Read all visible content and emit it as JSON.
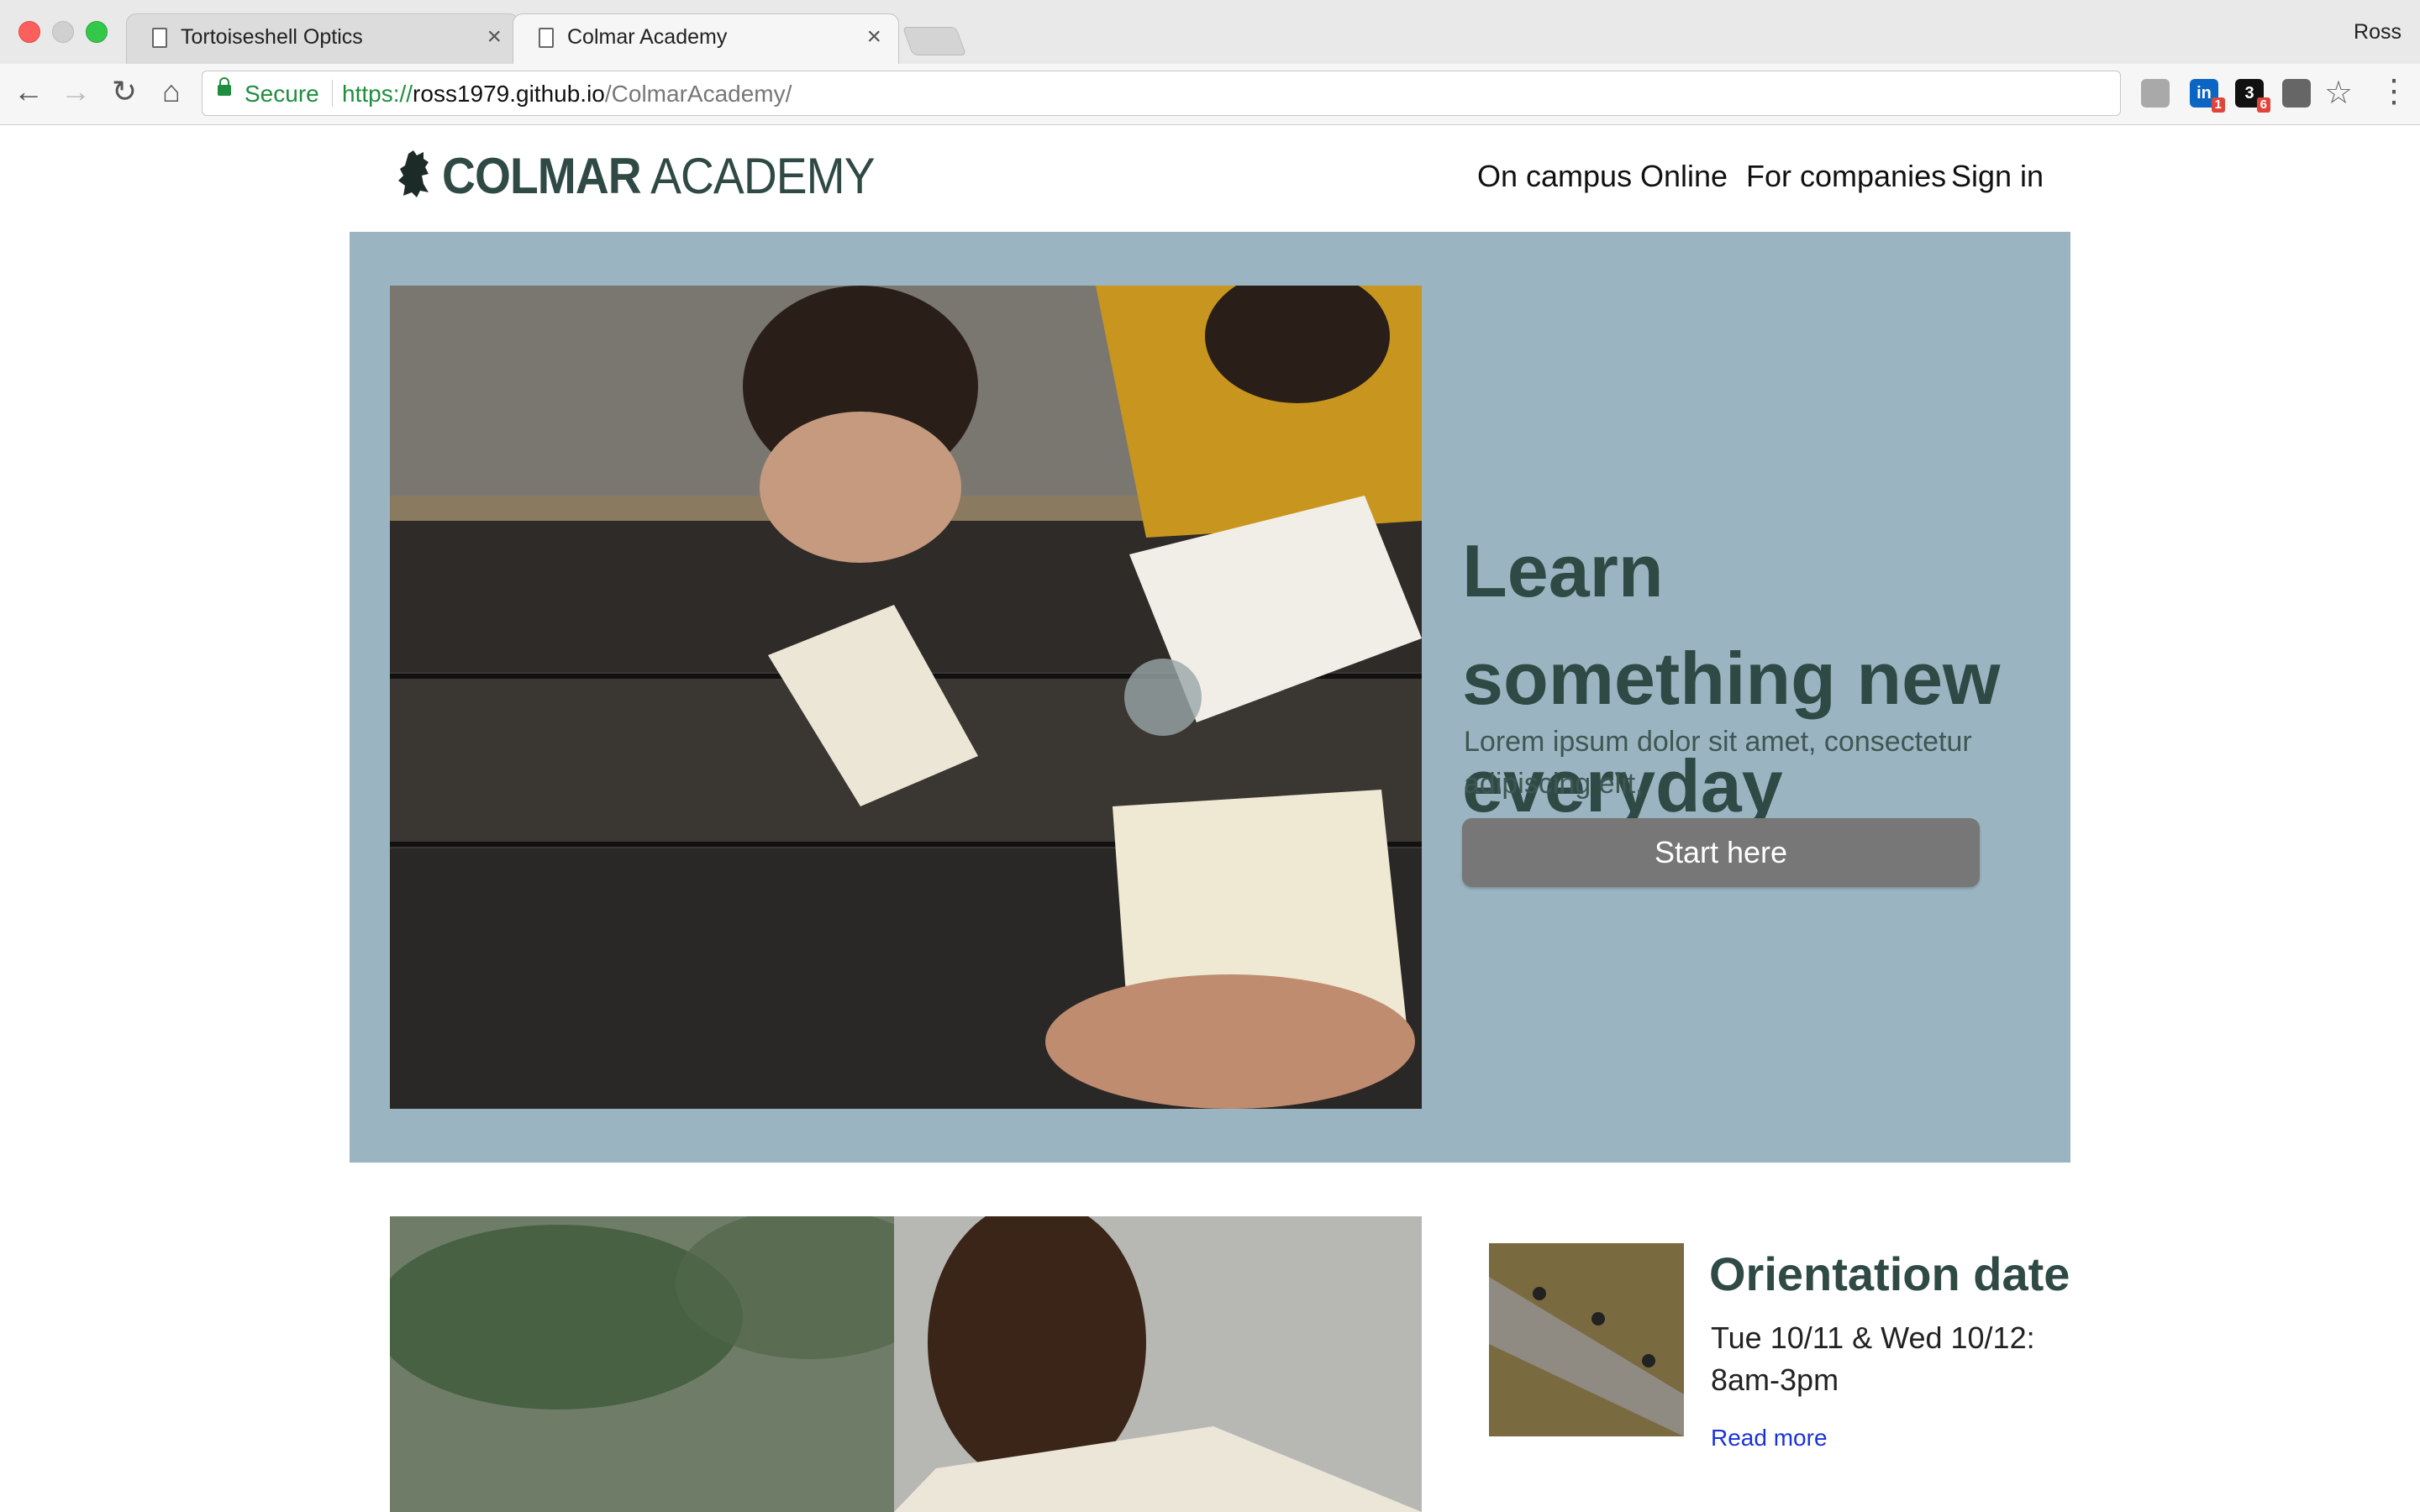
{
  "browser": {
    "tabs": [
      {
        "title": "Tortoiseshell Optics",
        "active": false
      },
      {
        "title": "Colmar Academy",
        "active": true
      }
    ],
    "profile_name": "Ross",
    "secure_label": "Secure",
    "url": {
      "scheme": "https://",
      "host": "ross1979.github.io",
      "path": "/ColmarAcademy/"
    },
    "extensions": [
      {
        "icon": "extension-gray-icon"
      },
      {
        "icon": "linkedin-icon",
        "label": "in",
        "badge": "1"
      },
      {
        "icon": "dark-extension-icon",
        "label": "3",
        "badge": "6"
      },
      {
        "icon": "lightbulb-extension-icon"
      }
    ]
  },
  "site": {
    "logo": {
      "bold": "COLMAR",
      "light": " ACADEMY"
    },
    "nav": [
      "On campus",
      "Online",
      "For companies",
      "Sign in"
    ],
    "hero": {
      "title": "Learn something new everyday",
      "text": "Lorem ipsum dolor sit amet, consectetur adipiscing elit,",
      "button": "Start here"
    },
    "event": {
      "title": "Orientation date",
      "date": "Tue 10/11 & Wed 10/12: 8am-3pm",
      "link": "Read more"
    }
  },
  "colors": {
    "hero_bg": "#9ab5c1",
    "brand_text": "#2f4a45",
    "button": "#777777",
    "link": "#1a33d6"
  }
}
